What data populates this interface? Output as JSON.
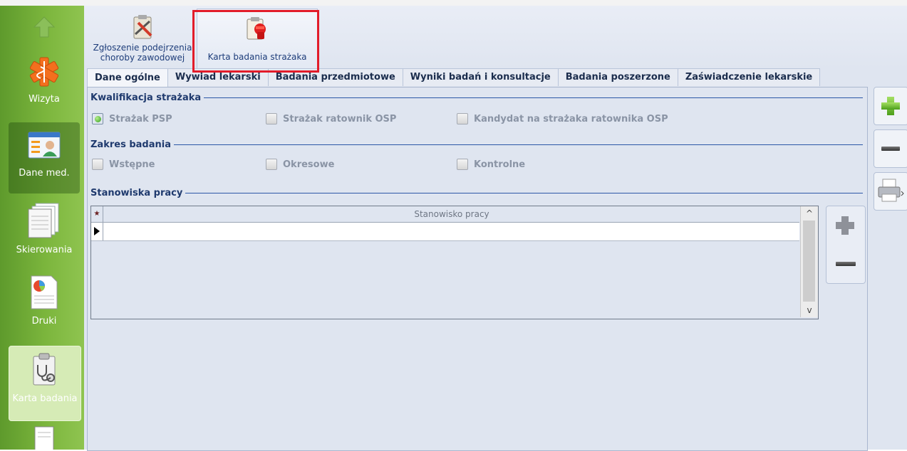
{
  "sidebar": {
    "items": [
      {
        "label": ""
      },
      {
        "label": "Wizyta"
      },
      {
        "label": "Dane med."
      },
      {
        "label": "Skierowania"
      },
      {
        "label": "Druki"
      },
      {
        "label": "Karta badania"
      },
      {
        "label": ""
      }
    ]
  },
  "ribbon": {
    "btn1_line1": "Zgłoszenie podejrzenia",
    "btn1_line2": "choroby zawodowej",
    "btn2_label": "Karta badania strażaka"
  },
  "tabs": [
    {
      "label": "Dane ogólne"
    },
    {
      "label": "Wywiad lekarski"
    },
    {
      "label": "Badania przedmiotowe"
    },
    {
      "label": "Wyniki badań i konsultacje"
    },
    {
      "label": "Badania poszerzone"
    },
    {
      "label": "Zaświadczenie lekarskie"
    }
  ],
  "form": {
    "kwalifikacja_title": "Kwalifikacja strażaka",
    "kwalifikacja_options": [
      "Strażak PSP",
      "Strażak ratownik OSP",
      "Kandydat na strażaka ratownika OSP"
    ],
    "zakres_title": "Zakres badania",
    "zakres_options": [
      "Wstępne",
      "Okresowe",
      "Kontrolne"
    ],
    "stanowiska_title": "Stanowiska pracy",
    "grid_column": "Stanowisko pracy",
    "grid_star": "★"
  },
  "colors": {
    "accent": "#2b57a7",
    "highlight": "#e21c2a",
    "sidebar": "#7cb63d"
  }
}
